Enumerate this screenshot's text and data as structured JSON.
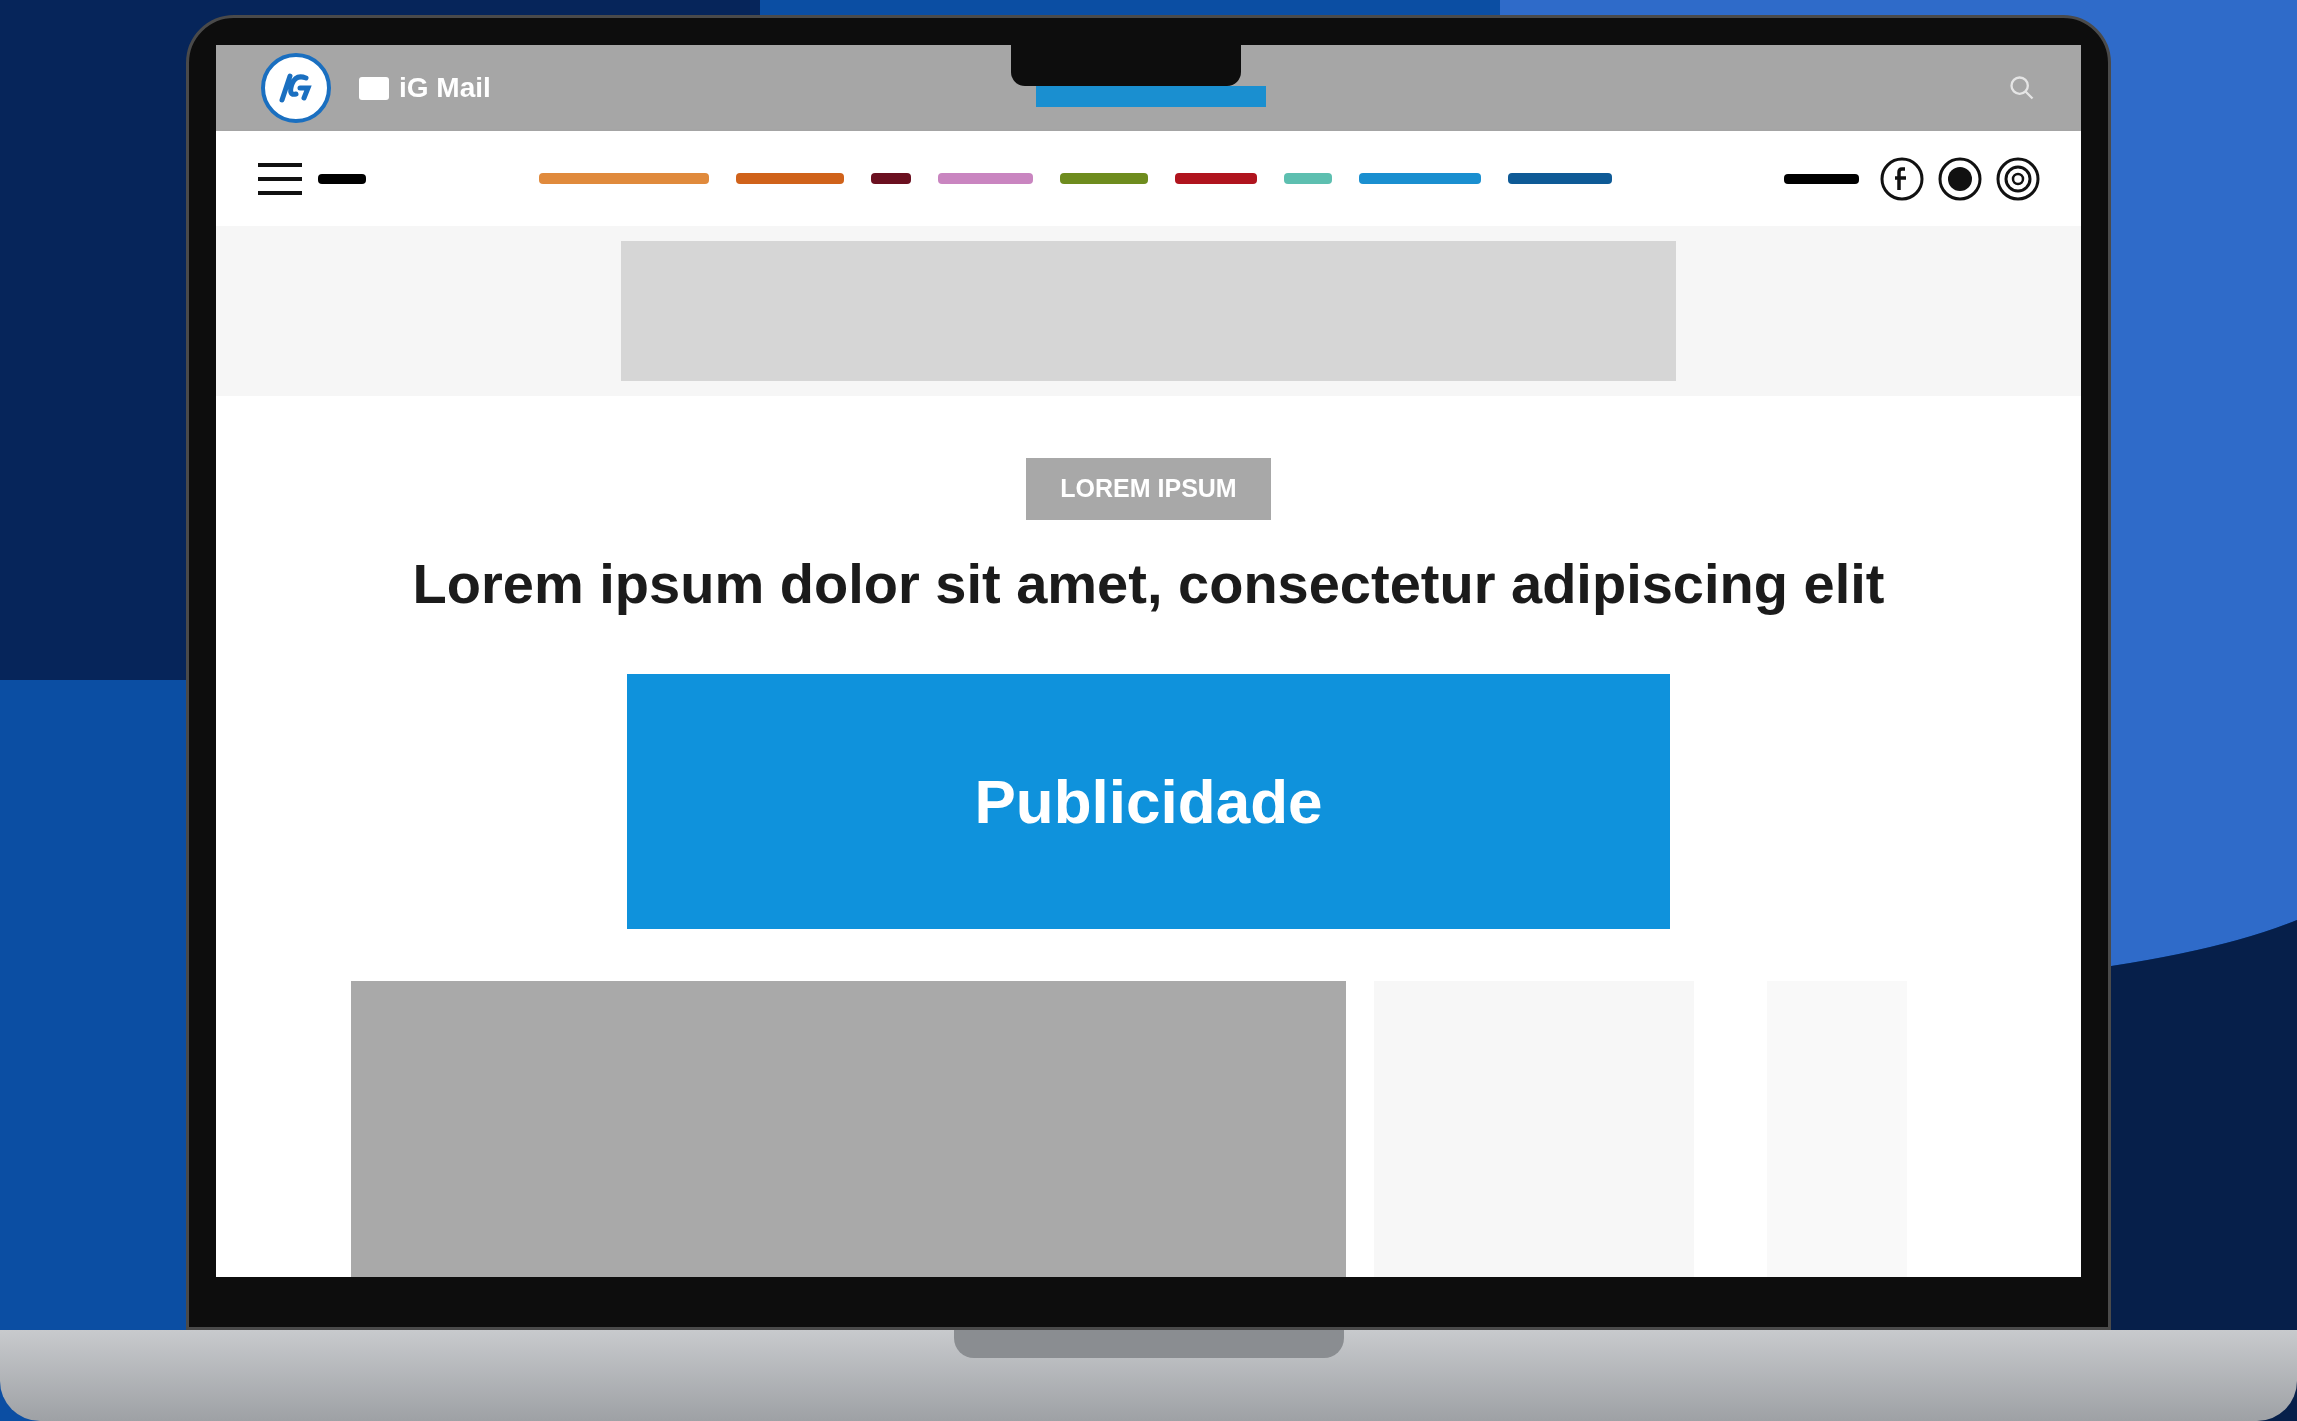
{
  "top_bar": {
    "mail_label": "iG Mail"
  },
  "nav": {
    "categories": [
      {
        "color": "#e08a3c"
      },
      {
        "color": "#d0621a"
      },
      {
        "color": "#6b1020"
      },
      {
        "color": "#c985c0"
      },
      {
        "color": "#6e8c1e"
      },
      {
        "color": "#b0141e"
      },
      {
        "color": "#5dbfb0"
      },
      {
        "color": "#1a8fd0"
      },
      {
        "color": "#0e5a96"
      }
    ]
  },
  "article": {
    "tag": "LOREM IPSUM",
    "headline": "Lorem ipsum dolor sit amet, consectetur adipiscing elit"
  },
  "ad": {
    "label": "Publicidade"
  }
}
